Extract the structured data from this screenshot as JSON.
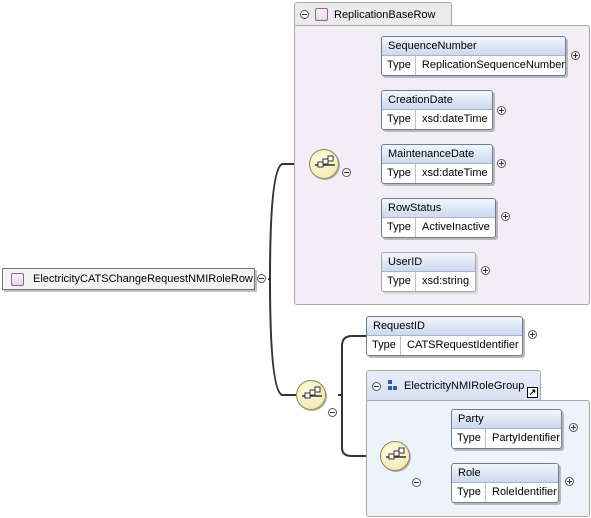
{
  "diagram": {
    "root": {
      "name": "ElectricityCATSChangeRequestNMIRoleRow"
    },
    "replication_group": {
      "name": "ReplicationBaseRow",
      "type_key": "Type",
      "children": [
        {
          "name": "SequenceNumber",
          "type": "ReplicationSequenceNumber"
        },
        {
          "name": "CreationDate",
          "type": "xsd:dateTime"
        },
        {
          "name": "MaintenanceDate",
          "type": "xsd:dateTime"
        },
        {
          "name": "RowStatus",
          "type": "ActiveInactive"
        },
        {
          "name": "UserID",
          "type": "xsd:string"
        }
      ]
    },
    "request": {
      "name": "RequestID",
      "type_key": "Type",
      "type": "CATSRequestIdentifier"
    },
    "role_group": {
      "name": "ElectricityNMIRoleGroup",
      "type_key": "Type",
      "children": [
        {
          "name": "Party",
          "type": "PartyIdentifier"
        },
        {
          "name": "Role",
          "type": "RoleIdentifier"
        }
      ]
    },
    "icons": {
      "collapse": "collapse-icon",
      "expand": "expand-icon",
      "sequence": "sequence-compositor-icon",
      "group": "group-icon",
      "link": "link-arrow-icon"
    },
    "colors": {
      "header_gradient_top": "#f2f6fd",
      "header_gradient_bottom": "#cdd9ef",
      "replication_panel": "#f3eef5",
      "group_panel": "#eef2fa",
      "connector": "#333333"
    }
  }
}
